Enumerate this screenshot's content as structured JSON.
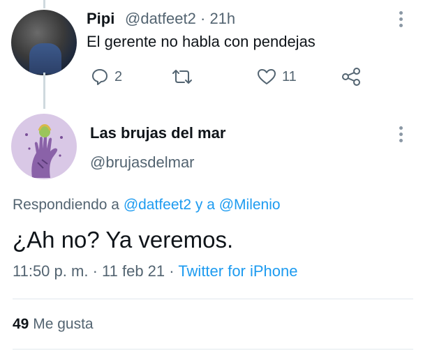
{
  "parent_tweet": {
    "display_name": "Pipi",
    "handle": "@datfeet2",
    "separator": "·",
    "time": "21h",
    "text": "El gerente no habla con pendejas",
    "reply_count": "2",
    "like_count": "11"
  },
  "main_tweet": {
    "display_name": "Las brujas del mar",
    "handle": "@brujasdelmar",
    "replying_prefix": "Respondiendo a",
    "mention_1": "@datfeet2",
    "replying_join": "y a",
    "mention_2": "@Milenio",
    "text": "¿Ah no? Ya veremos.",
    "time": "11:50 p. m.",
    "sep1": "·",
    "date": "11 feb 21",
    "sep2": "·",
    "client": "Twitter for iPhone",
    "likes_count": "49",
    "likes_label": "Me gusta"
  },
  "colors": {
    "accent": "#1d9bf0",
    "secondary_text": "#536471",
    "primary_text": "#0f1419"
  },
  "icons": [
    "reply-icon",
    "retweet-icon",
    "like-icon",
    "share-icon",
    "more-icon"
  ]
}
